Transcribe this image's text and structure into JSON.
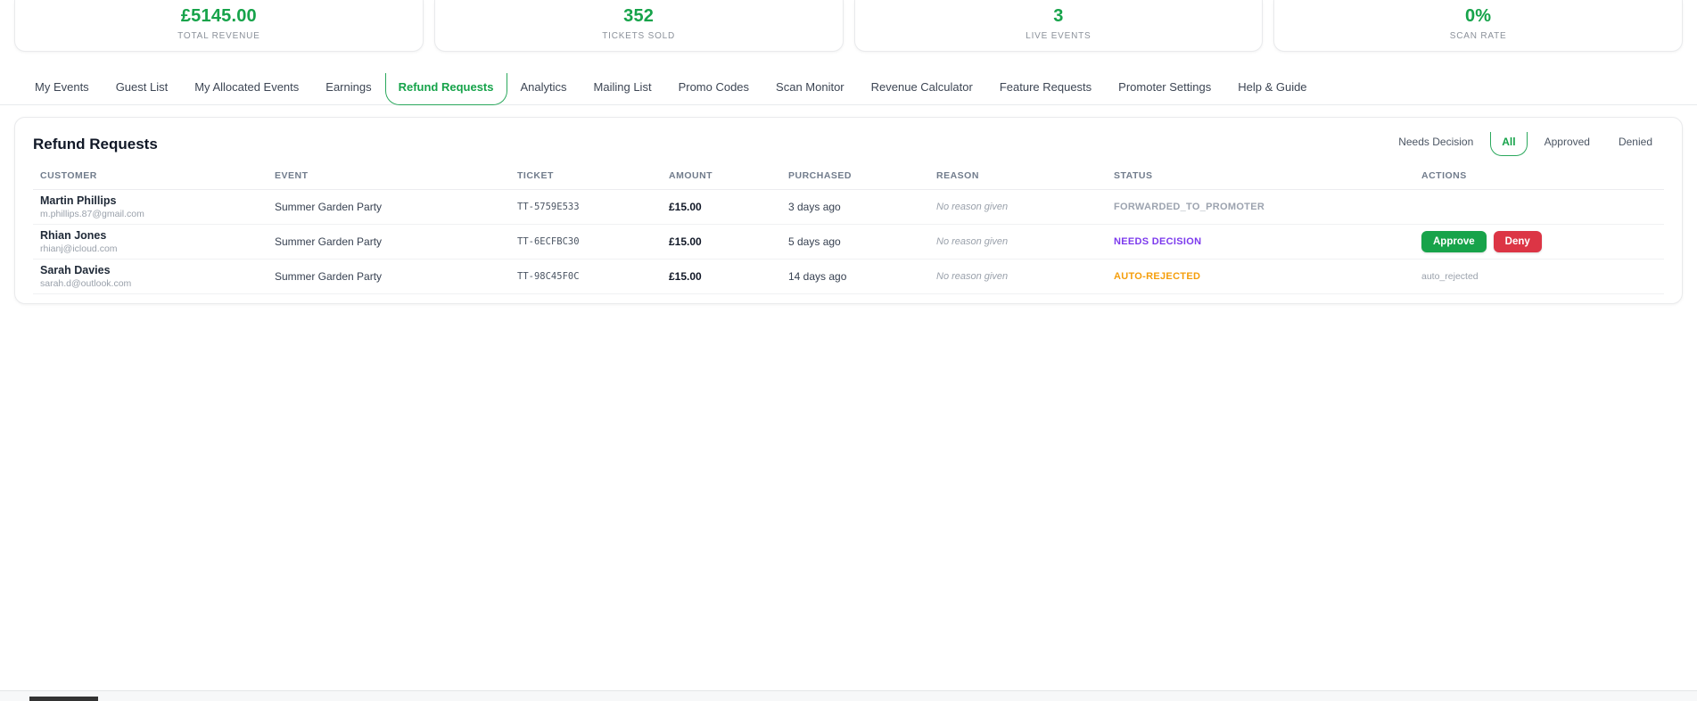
{
  "stats": [
    {
      "value": "£5145.00",
      "label": "TOTAL REVENUE"
    },
    {
      "value": "352",
      "label": "TICKETS SOLD"
    },
    {
      "value": "3",
      "label": "LIVE EVENTS"
    },
    {
      "value": "0%",
      "label": "SCAN RATE"
    }
  ],
  "nav": {
    "tabs": [
      {
        "label": "My Events",
        "active": false
      },
      {
        "label": "Guest List",
        "active": false
      },
      {
        "label": "My Allocated Events",
        "active": false
      },
      {
        "label": "Earnings",
        "active": false
      },
      {
        "label": "Refund Requests",
        "active": true
      },
      {
        "label": "Analytics",
        "active": false
      },
      {
        "label": "Mailing List",
        "active": false
      },
      {
        "label": "Promo Codes",
        "active": false
      },
      {
        "label": "Scan Monitor",
        "active": false
      },
      {
        "label": "Revenue Calculator",
        "active": false
      },
      {
        "label": "Feature Requests",
        "active": false
      },
      {
        "label": "Promoter Settings",
        "active": false
      },
      {
        "label": "Help & Guide",
        "active": false
      }
    ]
  },
  "panel": {
    "title": "Refund Requests",
    "filters": [
      {
        "label": "Needs Decision",
        "active": false
      },
      {
        "label": "All",
        "active": true
      },
      {
        "label": "Approved",
        "active": false
      },
      {
        "label": "Denied",
        "active": false
      }
    ],
    "table": {
      "columns": [
        "CUSTOMER",
        "EVENT",
        "TICKET",
        "AMOUNT",
        "PURCHASED",
        "REASON",
        "STATUS",
        "ACTIONS"
      ],
      "rows": [
        {
          "name": "Martin Phillips",
          "email": "m.phillips.87@gmail.com",
          "event": "Summer Garden Party",
          "ticket": "TT-5759E533",
          "amount": "£15.00",
          "purchased": "3 days ago",
          "reason": "No reason given",
          "status": "FORWARDED_TO_PROMOTER",
          "status_color": "#9ca3af"
        },
        {
          "name": "Rhian Jones",
          "email": "rhianj@icloud.com",
          "event": "Summer Garden Party",
          "ticket": "TT-6ECFBC30",
          "amount": "£15.00",
          "purchased": "5 days ago",
          "reason": "No reason given",
          "status": "NEEDS DECISION",
          "status_color": "#7c3aed",
          "approve_label": "Approve",
          "deny_label": "Deny"
        },
        {
          "name": "Sarah Davies",
          "email": "sarah.d@outlook.com",
          "event": "Summer Garden Party",
          "ticket": "TT-98C45F0C",
          "amount": "£15.00",
          "purchased": "14 days ago",
          "reason": "No reason given",
          "status": "AUTO-REJECTED",
          "status_color": "#f59e0b",
          "action_note": "auto_rejected"
        }
      ]
    }
  },
  "colors": {
    "accent_green": "#16a34a",
    "approve_green": "#17a34a",
    "deny_red": "#dc3545",
    "status_purple": "#7c3aed",
    "status_orange": "#f59e0b",
    "status_gray": "#9ca3af"
  }
}
